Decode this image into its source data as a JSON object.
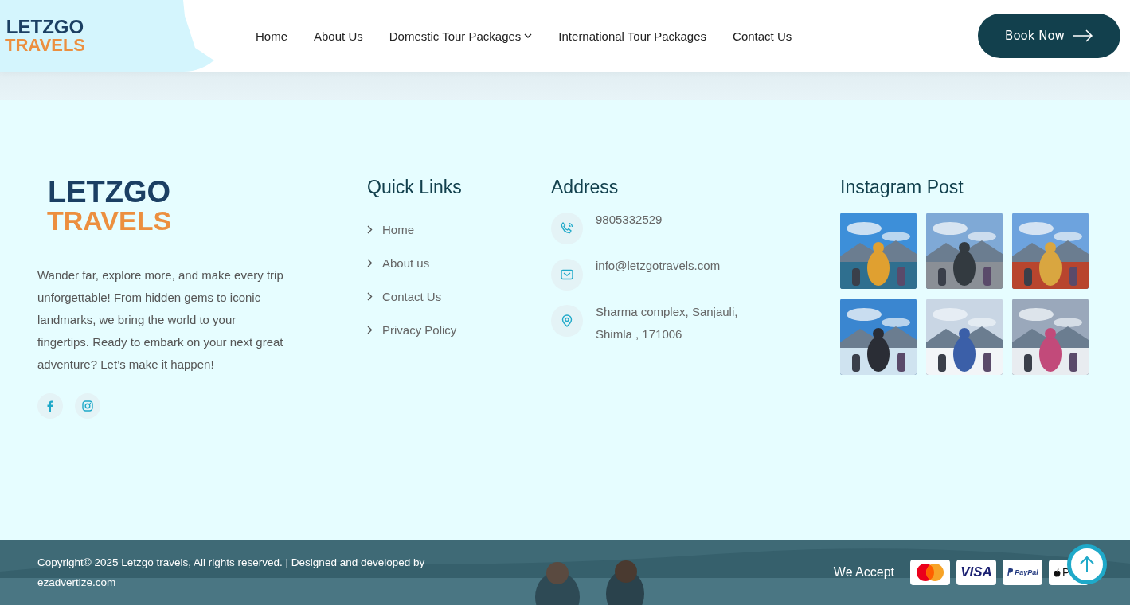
{
  "logo": {
    "line_1": "LETZGO",
    "line_2": "TRAVELS"
  },
  "nav": [
    {
      "label": "Home",
      "dropdown": false
    },
    {
      "label": "About Us",
      "dropdown": false
    },
    {
      "label": "Domestic Tour Packages",
      "dropdown": true
    },
    {
      "label": "International Tour Packages",
      "dropdown": false
    },
    {
      "label": "Contact Us",
      "dropdown": false
    }
  ],
  "book_button": "Book Now",
  "about": {
    "logo": {
      "line_1": "LETZGO",
      "line_2": "TRAVELS"
    },
    "text": "Wander far, explore more, and make every trip unforgettable! From hidden gems to iconic landmarks, we bring the world to your fingertips. Ready to embark on your next great adventure? Let’s make it happen!",
    "social": [
      {
        "kind": "facebook"
      },
      {
        "kind": "instagram"
      }
    ]
  },
  "quick_links": {
    "title": "Quick Links",
    "items": [
      "Home",
      "About us",
      "Contact Us",
      "Privacy Policy"
    ]
  },
  "address": {
    "title": "Address",
    "items": [
      {
        "kind": "phone",
        "text": "9805332529"
      },
      {
        "kind": "email",
        "text": "info@letzgotravels.com"
      },
      {
        "kind": "location",
        "text": "Sharma complex, Sanjauli, Shimla , 171006"
      }
    ]
  },
  "instagram": {
    "title": "Instagram Post"
  },
  "copyright": "Copyright© 2025 Letzgo travels, All rights reserved. | Designed and developed by ezadvertize.com",
  "we_accept": "We Accept",
  "payments": [
    {
      "kind": "mastercard"
    },
    {
      "kind": "visa",
      "label": "VISA"
    },
    {
      "kind": "paypal",
      "label": "PayPal"
    },
    {
      "kind": "apple",
      "label": "P"
    }
  ]
}
